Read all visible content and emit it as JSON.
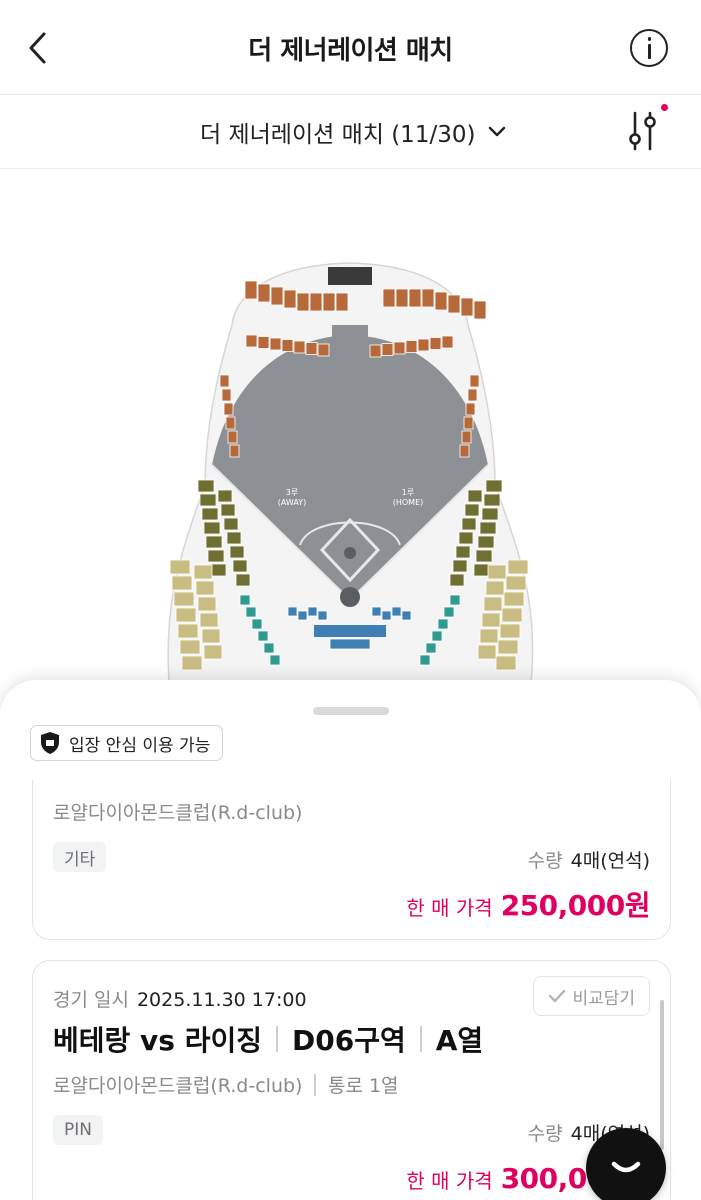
{
  "header": {
    "title": "더 제너레이션 매치"
  },
  "match_selector": {
    "label": "더 제너레이션 매치 (11/30)"
  },
  "map": {
    "labels": {
      "third_base": "3루",
      "third_base_sub": "(AWAY)",
      "first_base": "1루",
      "first_base_sub": "(HOME)"
    }
  },
  "sheet": {
    "safe_badge": "입장 안심 이용 가능",
    "cards": [
      {
        "venue": "로얄다이아몬드클럽(R.d-club)",
        "tag": "기타",
        "qty_label": "수량",
        "qty_value": "4매(연석)",
        "price_label": "한 매 가격",
        "price_value": "250,000원"
      },
      {
        "date_label": "경기 일시",
        "date_value": "2025.11.30 17:00",
        "compare_label": "비교담기",
        "teams": "베테랑 vs 라이징",
        "section": "D06구역",
        "row": "A열",
        "venue": "로얄다이아몬드클럽(R.d-club)",
        "aisle": "통로 1열",
        "tag": "PIN",
        "qty_label": "수량",
        "qty_value": "4매(연석)",
        "price_label": "한 매 가격",
        "price_value": "300,000원"
      }
    ]
  },
  "icons": {
    "back": "chevron-left-icon",
    "info": "info-icon",
    "dropdown": "chevron-down-icon",
    "filter": "sliders-icon",
    "shield": "shield-icon",
    "check": "check-icon",
    "chat": "chat-icon"
  },
  "colors": {
    "accent_pink": "#e0005f",
    "field_gray": "#8d9196",
    "section_brown": "#b8693a",
    "section_olive": "#6f6f32",
    "section_tan": "#c9bd84",
    "section_blue": "#3f7fb3",
    "section_teal": "#2f9a8f"
  }
}
